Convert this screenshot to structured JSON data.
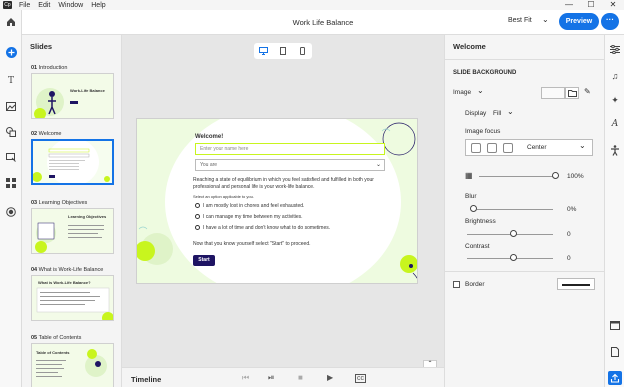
{
  "menu": {
    "app_icon_text": "Cp",
    "items": [
      "File",
      "Edit",
      "Window",
      "Help"
    ]
  },
  "window_controls": [
    "—",
    "☐",
    "✕"
  ],
  "header": {
    "title": "Work Life Balance",
    "fit": "Best Fit",
    "preview": "Preview",
    "more": "···"
  },
  "slides_panel": {
    "title": "Slides",
    "slides": [
      {
        "num": "01",
        "title": "Introduction",
        "thumb_title": "Work-Life Balance"
      },
      {
        "num": "02",
        "title": "Welcome",
        "thumb_title": "Welcome!"
      },
      {
        "num": "03",
        "title": "Learning Objectives",
        "thumb_title": "Learning Objectives"
      },
      {
        "num": "04",
        "title": "What is Work-Life Balance",
        "thumb_title": "What is Work-Life Balance?"
      },
      {
        "num": "05",
        "title": "Table of Contents",
        "thumb_title": "Table of Contents"
      }
    ]
  },
  "canvas": {
    "heading": "Welcome!",
    "name_placeholder": "Enter your name here",
    "select_value": "You are",
    "paragraph_line1": "Reaching a state of equilibrium in which you feel satisfied and fulfilled in both your",
    "paragraph_line2": "professional and personal life is your work-life balance.",
    "instruction": "Select an option applicable to you.",
    "options": [
      "I am mostly lost in chores and feel exhausted.",
      "I can manage my time between my activities.",
      "I have a lot of time and don't know what to do sometimes."
    ],
    "proceed": "Now that you know yourself select \"Start\" to proceed.",
    "start_button": "Start"
  },
  "timeline": {
    "label": "Timeline"
  },
  "properties": {
    "title": "Welcome",
    "section": "SLIDE BACKGROUND",
    "type_label": "Image",
    "display_label": "Display",
    "display_value": "Fill",
    "focus_label": "Image focus",
    "focus_value": "Center",
    "opacity_value": "100%",
    "blur_label": "Blur",
    "blur_value": "0%",
    "brightness_label": "Brightness",
    "brightness_value": "0",
    "contrast_label": "Contrast",
    "contrast_value": "0",
    "border_label": "Border"
  },
  "colors": {
    "accent": "#1473e6",
    "theme_purple": "#1e1463",
    "theme_green": "#c8f51e"
  }
}
